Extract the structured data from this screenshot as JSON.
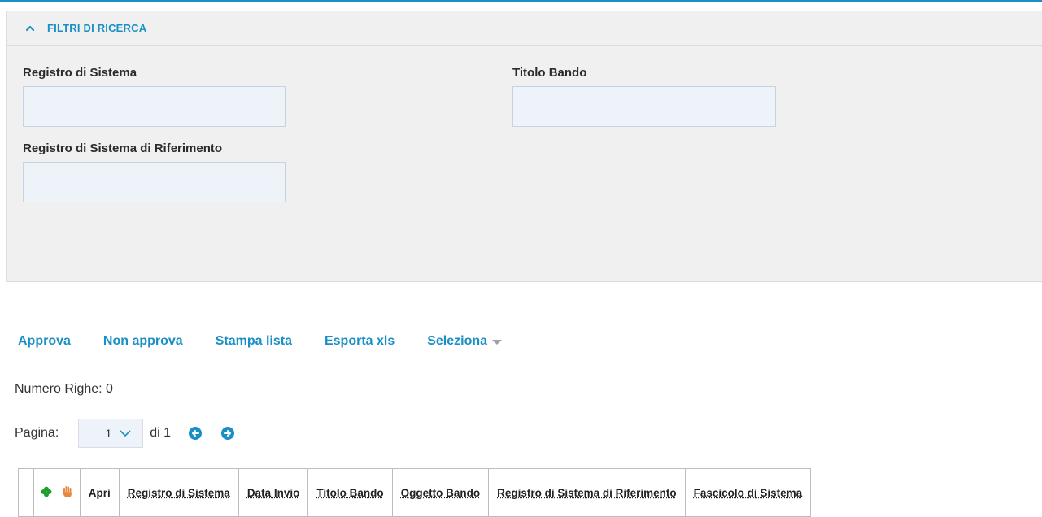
{
  "filters": {
    "header_label": "FILTRI DI RICERCA",
    "fields": {
      "registro_sistema": {
        "label": "Registro di Sistema",
        "value": "",
        "placeholder": ""
      },
      "titolo_bando": {
        "label": "Titolo Bando",
        "value": "",
        "placeholder": ""
      },
      "registro_riferimento": {
        "label": "Registro di Sistema di Riferimento",
        "value": "",
        "placeholder": ""
      }
    }
  },
  "toolbar": {
    "approva": "Approva",
    "non_approva": "Non approva",
    "stampa_lista": "Stampa lista",
    "esporta_xls": "Esporta xls",
    "seleziona": "Seleziona"
  },
  "rowcount": "Numero Righe: 0",
  "pager": {
    "label": "Pagina:",
    "current": "1",
    "of": "di 1"
  },
  "table": {
    "columns": [
      "Apri",
      "Registro di Sistema",
      "Data Invio",
      "Titolo Bando",
      "Oggetto Bando",
      "Registro di Sistema di Riferimento",
      "Fascicolo di Sistema"
    ]
  },
  "colors": {
    "accent": "#1a8fc6",
    "panel_bg": "#f0f0f0",
    "input_bg": "#eef3f9",
    "clover": "#1e9e2e",
    "hand": "#e8873a"
  },
  "icons": [
    "chevron-up-icon",
    "caret-down-icon",
    "chevron-down-icon",
    "arrow-left-circle-icon",
    "arrow-right-circle-icon",
    "clover-icon",
    "hand-icon"
  ]
}
